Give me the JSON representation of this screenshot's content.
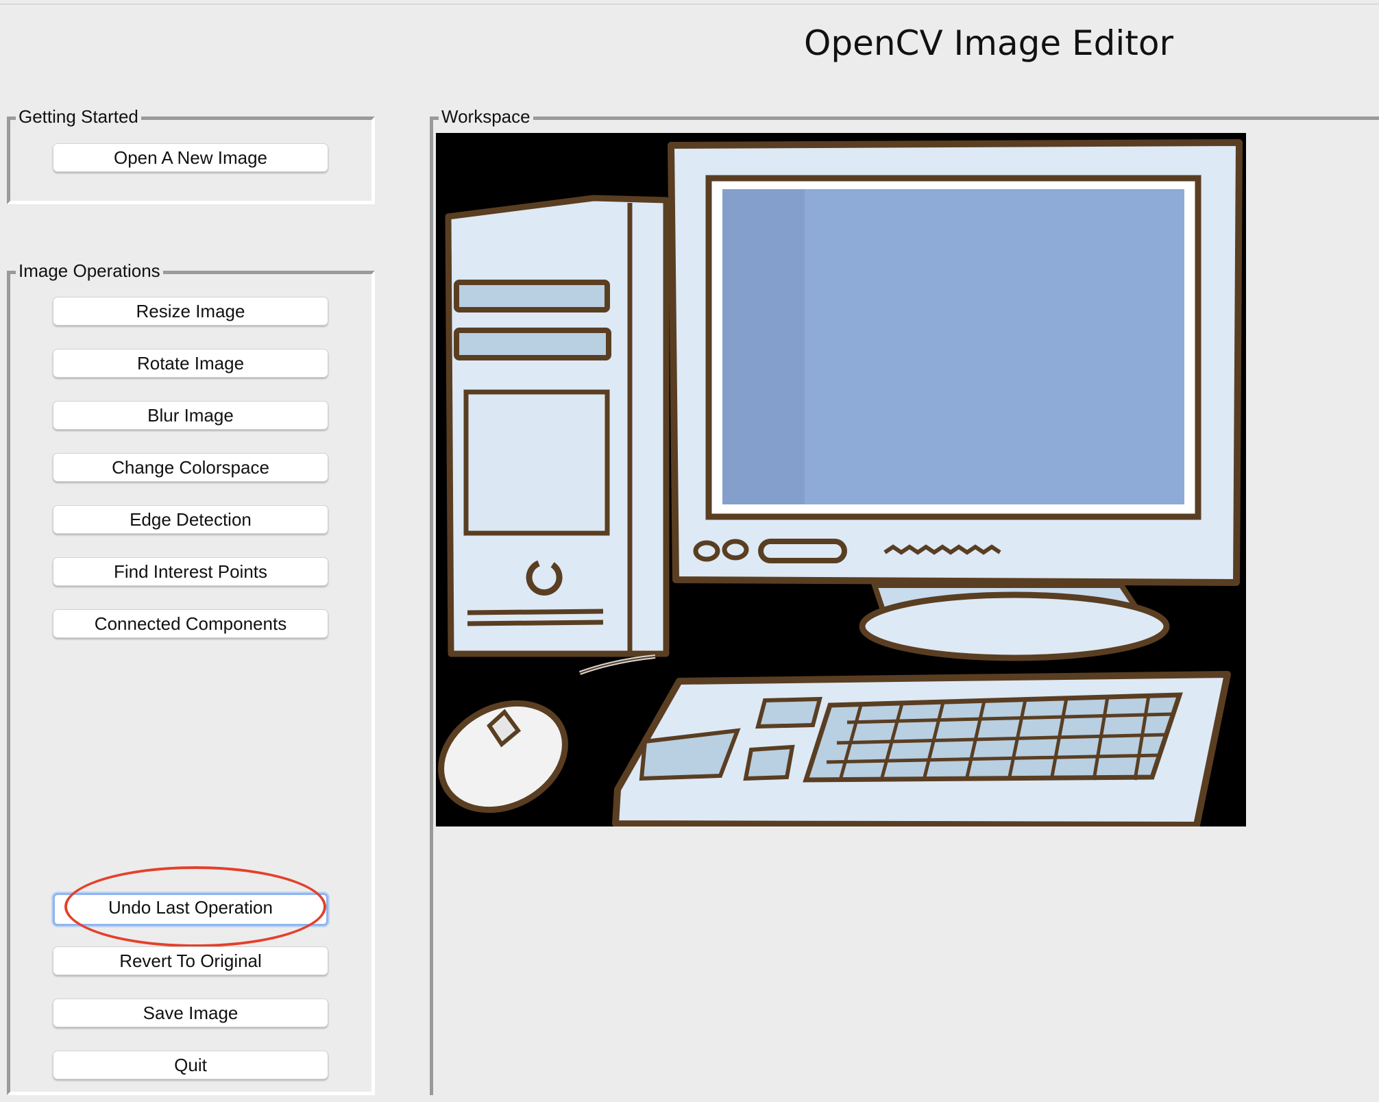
{
  "window": {
    "title": "OpenCV Image Editor"
  },
  "getting_started": {
    "label": "Getting Started",
    "open_button": "Open A New Image"
  },
  "image_operations": {
    "label": "Image Operations",
    "buttons": [
      "Resize Image",
      "Rotate Image",
      "Blur Image",
      "Change Colorspace",
      "Edge Detection",
      "Find Interest Points",
      "Connected Components"
    ],
    "undo_button": "Undo Last Operation",
    "revert_button": "Revert To Original",
    "save_button": "Save Image",
    "quit_button": "Quit"
  },
  "workspace": {
    "label": "Workspace"
  },
  "colors": {
    "background": "#ececec",
    "focus_ring": "#8fb6ef",
    "annotation": "#e4402b",
    "canvas": "#000000"
  }
}
